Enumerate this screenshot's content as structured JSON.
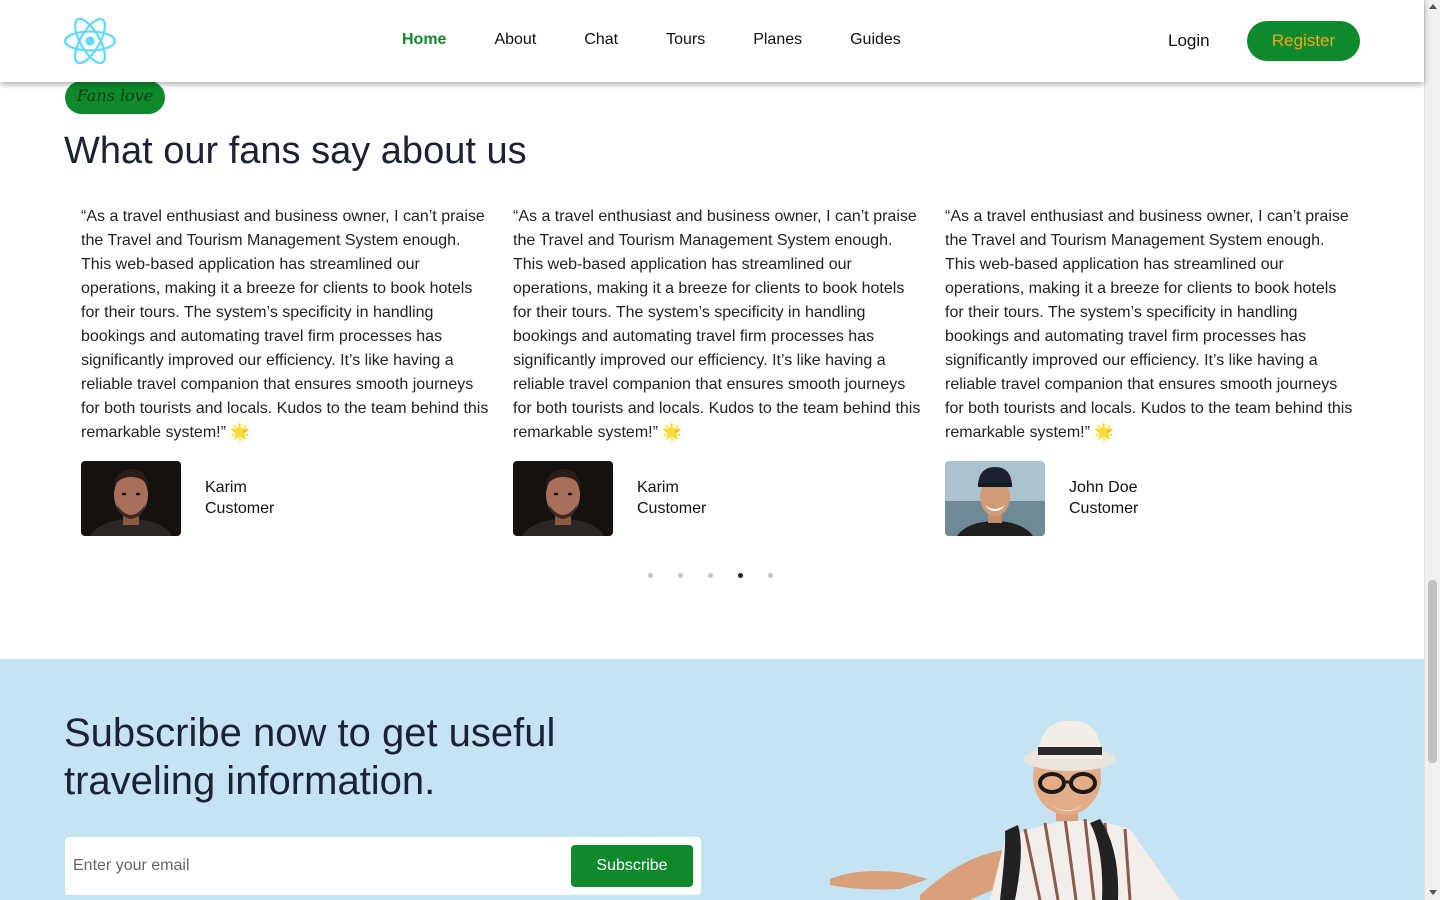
{
  "nav": {
    "items": [
      "Home",
      "About",
      "Chat",
      "Tours",
      "Planes",
      "Guides"
    ],
    "active": "Home",
    "login": "Login",
    "register": "Register"
  },
  "fans": {
    "badge": "Fans love",
    "title": "What our fans say about us",
    "testimonials": [
      {
        "quote": "“As a travel enthusiast and business owner, I can’t praise the Travel and Tourism Management System enough. This web-based application has streamlined our operations, making it a breeze for clients to book hotels for their tours. The system’s specificity in handling bookings and automating travel firm processes has significantly improved our efficiency. It’s like having a reliable travel companion that ensures smooth journeys for both tourists and locals. Kudos to the team behind this remarkable system!” 🌟",
        "name": "Karim",
        "role": "Customer"
      },
      {
        "quote": "“As a travel enthusiast and business owner, I can’t praise the Travel and Tourism Management System enough. This web-based application has streamlined our operations, making it a breeze for clients to book hotels for their tours. The system’s specificity in handling bookings and automating travel firm processes has significantly improved our efficiency. It’s like having a reliable travel companion that ensures smooth journeys for both tourists and locals. Kudos to the team behind this remarkable system!” 🌟",
        "name": "Karim",
        "role": "Customer"
      },
      {
        "quote": "“As a travel enthusiast and business owner, I can’t praise the Travel and Tourism Management System enough. This web-based application has streamlined our operations, making it a breeze for clients to book hotels for their tours. The system’s specificity in handling bookings and automating travel firm processes has significantly improved our efficiency. It’s like having a reliable travel companion that ensures smooth journeys for both tourists and locals. Kudos to the team behind this remarkable system!” 🌟",
        "name": "John Doe",
        "role": "Customer"
      }
    ],
    "dots_count": 5,
    "active_dot": 4
  },
  "subscribe": {
    "title": "Subscribe now to get useful traveling information.",
    "placeholder": "Enter your email",
    "button": "Subscribe"
  },
  "colors": {
    "brand_green": "#0e8a2c",
    "register_text": "#f5a524",
    "subscribe_bg": "#c6e3f3",
    "logo_cyan": "#61dafb"
  },
  "icons": {
    "logo": "react-atom-icon"
  }
}
